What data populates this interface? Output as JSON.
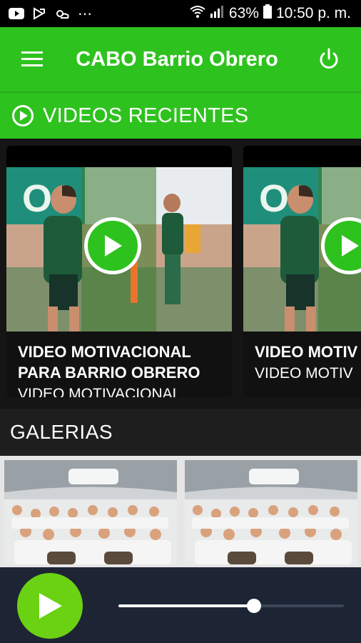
{
  "status_bar": {
    "battery": "63%",
    "time": "10:50 p. m."
  },
  "app_bar": {
    "title": "CABO Barrio Obrero"
  },
  "recent_section": {
    "label": "VIDEOS RECIENTES"
  },
  "videos": [
    {
      "title": "VIDEO MOTIVACIONAL PARA BARRIO OBRERO",
      "subtitle": "VIDEO MOTIVACIONAL"
    },
    {
      "title": "VIDEO MOTIV",
      "subtitle": "VIDEO MOTIV"
    }
  ],
  "galleries_section": {
    "label": "GALERIAS"
  },
  "player": {
    "progress": 0.6
  },
  "colors": {
    "accent": "#2ec21f",
    "play_button": "#6bd113",
    "player_bg": "#1d2535"
  }
}
